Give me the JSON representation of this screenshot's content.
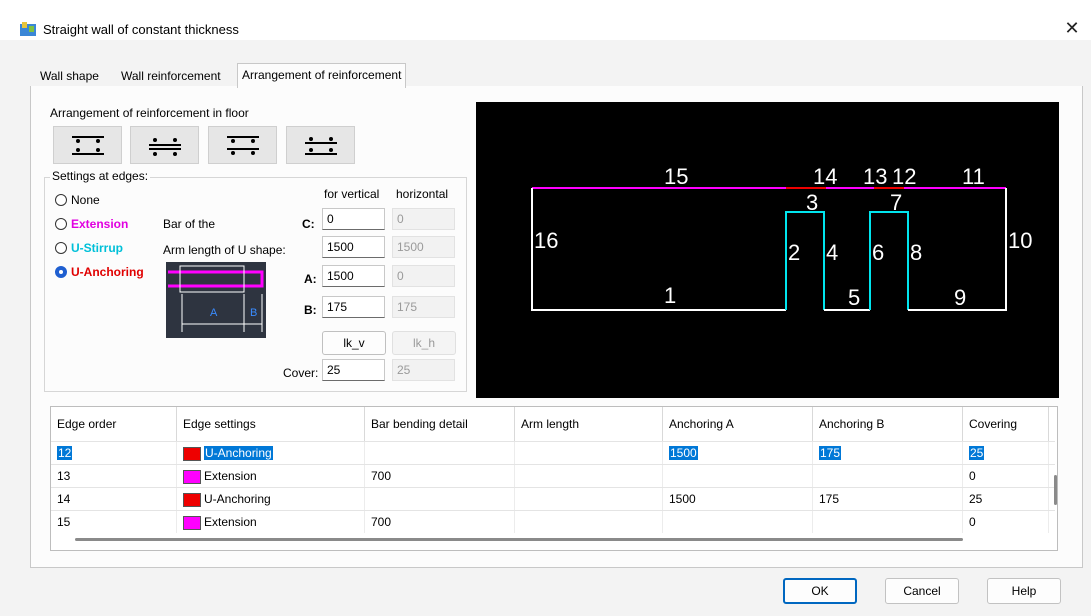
{
  "window": {
    "title": "Straight wall of constant thickness",
    "close_icon": "close-icon"
  },
  "tabs": [
    {
      "label": "Wall shape",
      "active": false
    },
    {
      "label": "Wall reinforcement",
      "active": false
    },
    {
      "label": "Arrangement of reinforcement",
      "active": true
    }
  ],
  "floor": {
    "label": "Arrangement of reinforcement in floor"
  },
  "edges": {
    "group_title": "Settings at edges:",
    "options": [
      {
        "label": "None",
        "checked": false
      },
      {
        "label": "Extension",
        "checked": false
      },
      {
        "label": "U-Stirrup",
        "checked": false
      },
      {
        "label": "U-Anchoring",
        "checked": true
      }
    ],
    "col_vertical": "for vertical",
    "col_horizontal": "horizontal",
    "bar_of_the": "Bar of the",
    "arm_length_label": "Arm length of U shape:",
    "c_label": "C:",
    "a_label": "A:",
    "b_label": "B:",
    "cover_label": "Cover:",
    "c_vertical": "0",
    "c_horizontal": "0",
    "arm_vertical": "1500",
    "arm_horizontal": "1500",
    "a_vertical": "1500",
    "a_horizontal": "0",
    "b_vertical": "175",
    "b_horizontal": "175",
    "lk_v": "lk_v",
    "lk_h": "lk_h",
    "cover_vertical": "25",
    "cover_horizontal": "25",
    "diagram_a": "A",
    "diagram_b": "B"
  },
  "sketch": {
    "labels": [
      "1",
      "2",
      "3",
      "4",
      "5",
      "6",
      "7",
      "8",
      "9",
      "10",
      "11",
      "12",
      "13",
      "14",
      "15",
      "16"
    ]
  },
  "table": {
    "columns": [
      "Edge order",
      "Edge settings",
      "Bar bending detail",
      "Arm length",
      "Anchoring A",
      "Anchoring B",
      "Covering"
    ],
    "rows": [
      {
        "order": "12",
        "color": "#ee0000",
        "setting": "U-Anchoring",
        "bending": "",
        "arm": "",
        "anch_a": "1500",
        "anch_b": "175",
        "cover": "25",
        "selected": true
      },
      {
        "order": "13",
        "color": "#ff00ff",
        "setting": "Extension",
        "bending": "700",
        "arm": "",
        "anch_a": "",
        "anch_b": "",
        "cover": "0",
        "selected": false
      },
      {
        "order": "14",
        "color": "#ee0000",
        "setting": "U-Anchoring",
        "bending": "",
        "arm": "",
        "anch_a": "1500",
        "anch_b": "175",
        "cover": "25",
        "selected": false
      },
      {
        "order": "15",
        "color": "#ff00ff",
        "setting": "Extension",
        "bending": "700",
        "arm": "",
        "anch_a": "",
        "anch_b": "",
        "cover": "0",
        "selected": false
      }
    ]
  },
  "buttons": {
    "ok": "OK",
    "cancel": "Cancel",
    "help": "Help"
  },
  "colors": {
    "magenta": "#ff00ff",
    "cyan": "#00e5ee",
    "red": "#ee0000",
    "selection": "#0078d7"
  }
}
